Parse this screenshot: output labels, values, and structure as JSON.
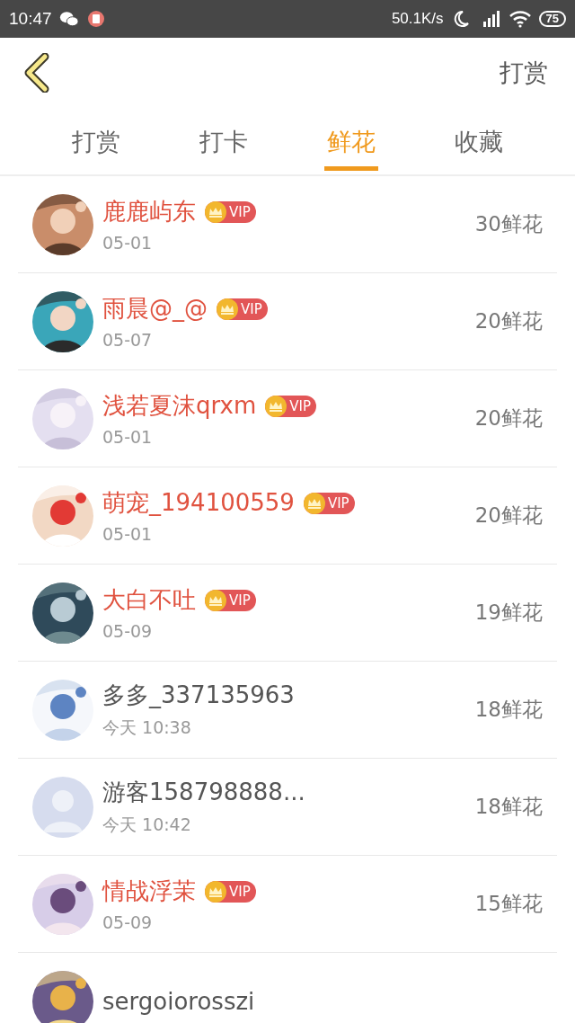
{
  "status_bar": {
    "time": "10:47",
    "speed": "50.1K/s",
    "battery": "75"
  },
  "header": {
    "action": "打赏"
  },
  "tabs": [
    {
      "label": "打赏",
      "selected": false
    },
    {
      "label": "打卡",
      "selected": false
    },
    {
      "label": "鲜花",
      "selected": true
    },
    {
      "label": "收藏",
      "selected": false
    }
  ],
  "rows": [
    {
      "name": "鹿鹿屿东",
      "vip": true,
      "badge": "VIP",
      "date": "05-01",
      "amount": "30鲜花"
    },
    {
      "name": "雨晨@_@",
      "vip": true,
      "badge": "VIP",
      "date": "05-07",
      "amount": "20鲜花"
    },
    {
      "name": "浅若夏沫qrxm",
      "vip": true,
      "badge": "VIP",
      "date": "05-01",
      "amount": "20鲜花"
    },
    {
      "name": "萌宠_194100559",
      "vip": true,
      "badge": "VIP",
      "date": "05-01",
      "amount": "20鲜花"
    },
    {
      "name": "大白不吐",
      "vip": true,
      "badge": "VIP",
      "date": "05-09",
      "amount": "19鲜花"
    },
    {
      "name": "多多_337135963",
      "vip": false,
      "date": "今天 10:38",
      "amount": "18鲜花"
    },
    {
      "name": "游客158798888...",
      "vip": false,
      "date": "今天 10:42",
      "amount": "18鲜花"
    },
    {
      "name": "情战浮茉",
      "vip": true,
      "badge": "VIP",
      "date": "05-09",
      "amount": "15鲜花"
    },
    {
      "name": "sergoiorosszi",
      "vip": false
    }
  ]
}
